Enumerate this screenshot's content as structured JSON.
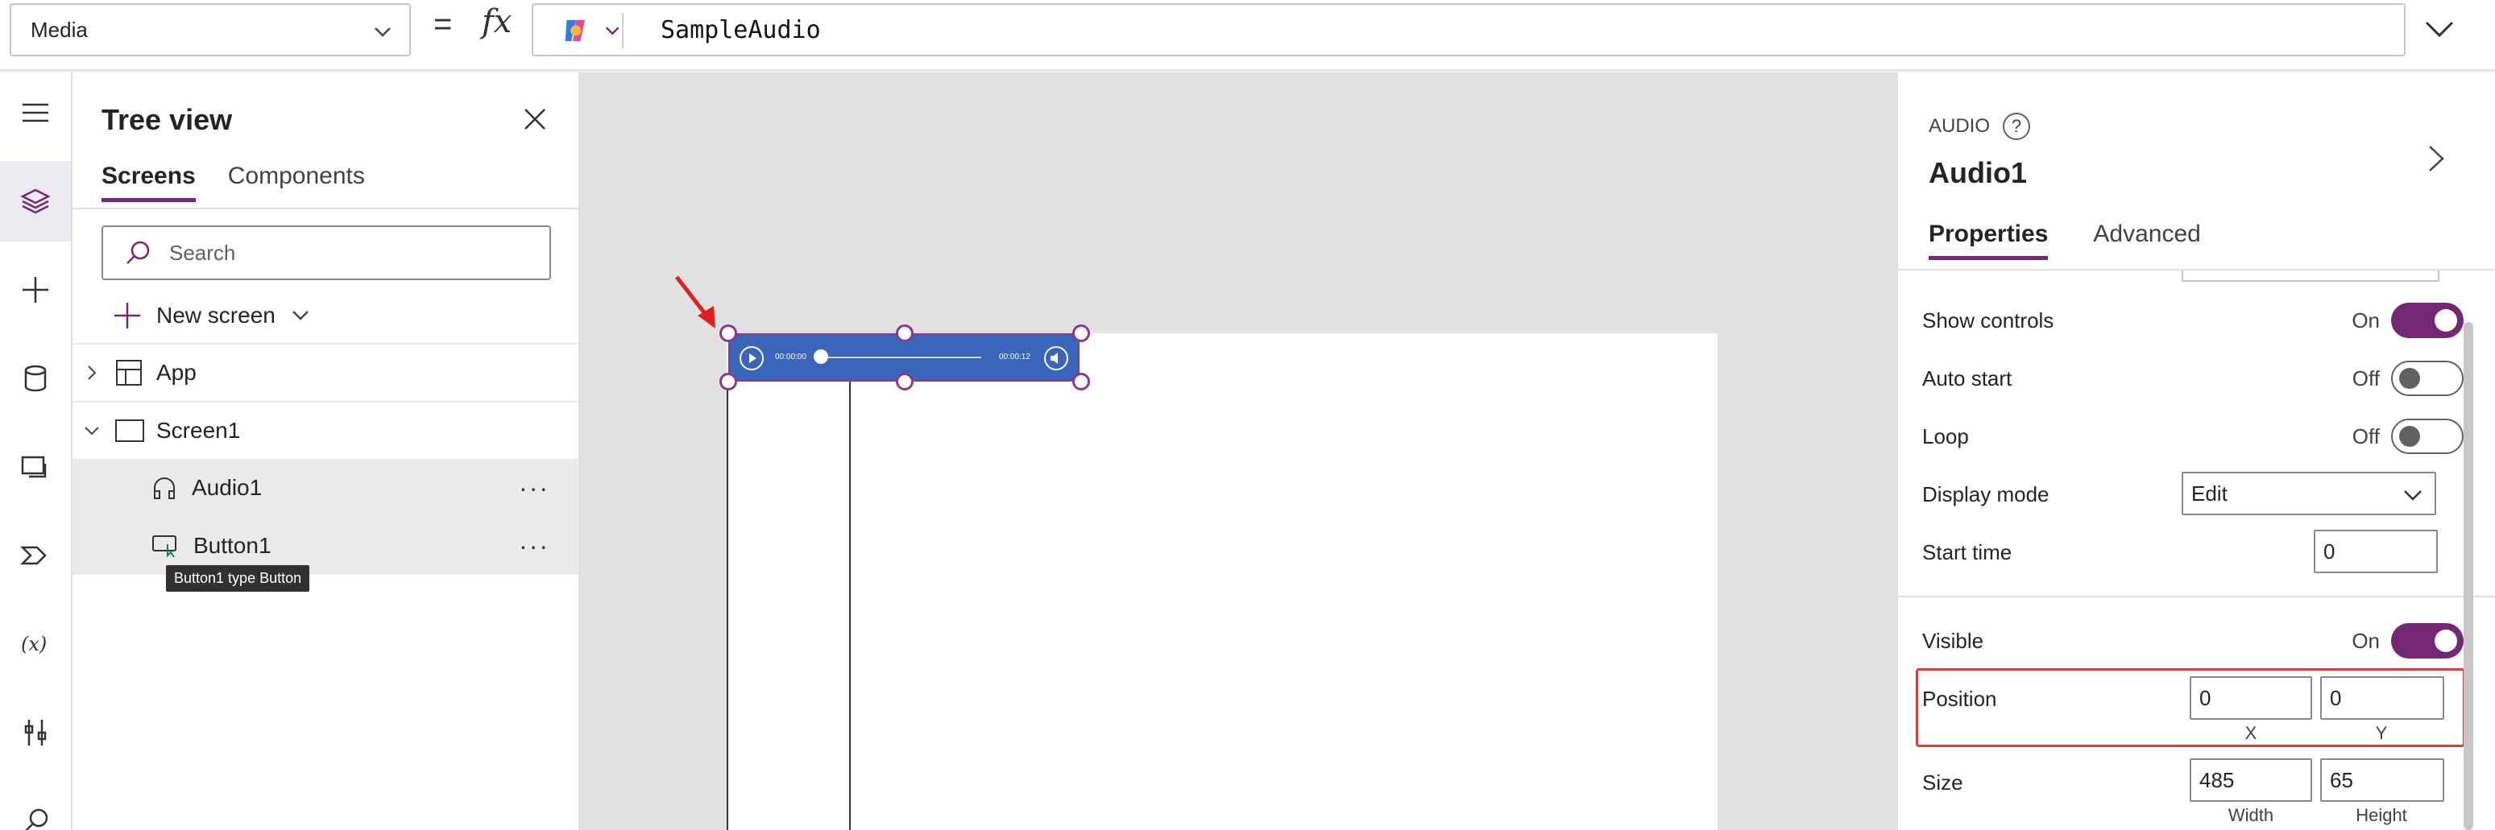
{
  "formula_bar": {
    "property": "Media",
    "equals": "=",
    "fx": "fx",
    "formula": "SampleAudio"
  },
  "tree_view": {
    "title": "Tree view",
    "tabs": [
      "Screens",
      "Components"
    ],
    "search_placeholder": "Search",
    "new_screen": "New screen",
    "items": [
      {
        "label": "App"
      },
      {
        "label": "Screen1"
      },
      {
        "label": "Audio1"
      },
      {
        "label": "Button1"
      }
    ],
    "tooltip": "Button1 type Button"
  },
  "canvas": {
    "audio_start_time": "00:00:00",
    "audio_end_time": "00:00:12"
  },
  "properties": {
    "type": "AUDIO",
    "name": "Audio1",
    "tabs": [
      "Properties",
      "Advanced"
    ],
    "show_controls": {
      "label": "Show controls",
      "value": "On"
    },
    "auto_start": {
      "label": "Auto start",
      "value": "Off"
    },
    "loop": {
      "label": "Loop",
      "value": "Off"
    },
    "display_mode": {
      "label": "Display mode",
      "value": "Edit"
    },
    "start_time": {
      "label": "Start time",
      "value": "0"
    },
    "visible": {
      "label": "Visible",
      "value": "On"
    },
    "position": {
      "label": "Position",
      "x": "0",
      "y": "0",
      "x_label": "X",
      "y_label": "Y"
    },
    "size": {
      "label": "Size",
      "width": "485",
      "height": "65",
      "width_label": "Width",
      "height_label": "Height"
    }
  },
  "colors": {
    "accent": "#742774",
    "audio_bg": "#3a66b9",
    "highlight": "#e03c3c"
  }
}
